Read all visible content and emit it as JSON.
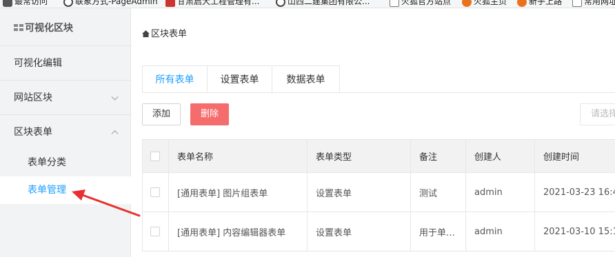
{
  "bookmarks": [
    {
      "label": "最常访问",
      "icon": "gear-icon"
    },
    {
      "label": "联象方式-PageAdmin",
      "icon": "globe-icon"
    },
    {
      "label": "甘肃启大工程管理有...",
      "icon": "flag-icon"
    },
    {
      "label": "山西二建集团有限公...",
      "icon": "globe-icon"
    },
    {
      "label": "火狐官方站点",
      "icon": "folder-icon"
    },
    {
      "label": "火狐主页",
      "icon": "firefox-icon"
    },
    {
      "label": "新手上路",
      "icon": "firefox-icon"
    },
    {
      "label": "常用网址",
      "icon": "folder-icon"
    }
  ],
  "sidebar": {
    "title": "可视化区块",
    "items": [
      {
        "label": "可视化编辑"
      },
      {
        "label": "网站区块",
        "chevron": "down"
      },
      {
        "label": "区块表单",
        "chevron": "up"
      }
    ],
    "subitems": [
      {
        "label": "表单分类",
        "active": false
      },
      {
        "label": "表单管理",
        "active": true
      }
    ]
  },
  "breadcrumb": {
    "label": "区块表单"
  },
  "tabs": [
    {
      "label": "所有表单",
      "active": true
    },
    {
      "label": "设置表单",
      "active": false
    },
    {
      "label": "数据表单",
      "active": false
    }
  ],
  "toolbar": {
    "add_label": "添加",
    "delete_label": "删除",
    "select_placeholder": "请选择"
  },
  "table": {
    "headers": [
      "表单名称",
      "表单类型",
      "备注",
      "创建人",
      "创建时间"
    ],
    "rows": [
      [
        "[通用表单] 图片组表单",
        "设置表单",
        "测试",
        "admin",
        "2021-03-23 16:4"
      ],
      [
        "[通用表单] 内容编辑器表单",
        "设置表单",
        "用于单…",
        "admin",
        "2021-03-10 15:1"
      ]
    ]
  },
  "colors": {
    "accent": "#1e9fff",
    "danger": "#f56c6c",
    "sidebar_bg": "#f2f3f5",
    "annotation_arrow": "#e8312f"
  }
}
